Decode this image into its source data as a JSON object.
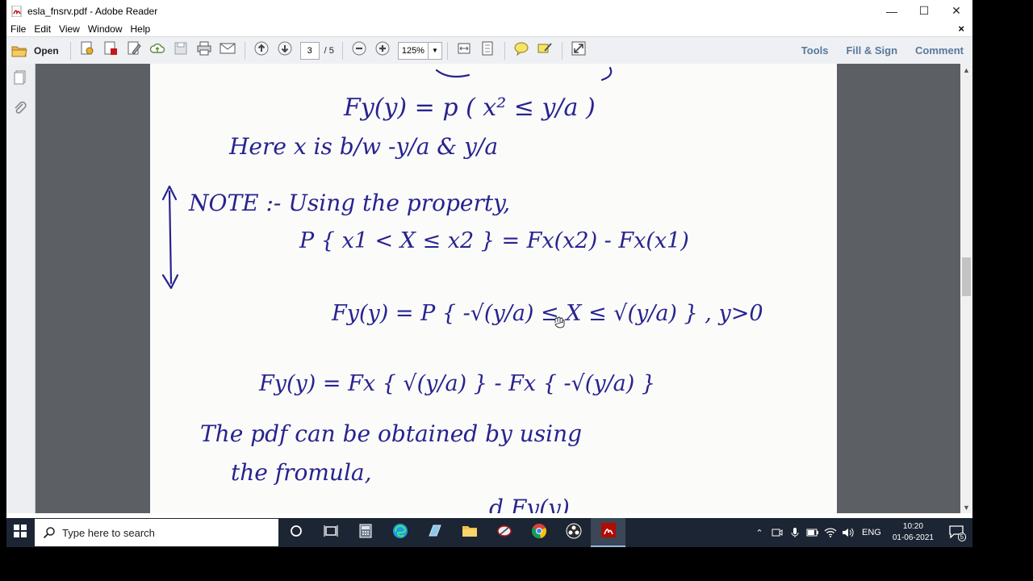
{
  "window": {
    "title": "esla_fnsrv.pdf - Adobe Reader",
    "minimize_glyph": "—",
    "maximize_glyph": "☐",
    "close_glyph": "✕"
  },
  "menu": {
    "items": [
      "File",
      "Edit",
      "View",
      "Window",
      "Help"
    ],
    "close_glyph": "×"
  },
  "toolbar": {
    "open_label": "Open",
    "current_page": "3",
    "total_pages": "/ 5",
    "zoom": "125%",
    "tools_label": "Tools",
    "fill_sign_label": "Fill & Sign",
    "comment_label": "Comment"
  },
  "document": {
    "handwritten_lines": [
      "Fy(y) = p ( x² ≤ y/a )",
      "Here x is b/w -y/a & y/a",
      "NOTE :- Using the property,",
      "P { x1 < X ≤ x2 } = Fx(x2) - Fx(x1)",
      "Fy(y) = P { -√(y/a) ≤ X ≤ √(y/a) } , y>0",
      "Fy(y) = Fx { √(y/a) } - Fx { -√(y/a) }",
      "The pdf can be obtained by using",
      "the fromula,",
      "d Fy(y)"
    ]
  },
  "taskbar": {
    "search_placeholder": "Type here to search",
    "language": "ENG",
    "time": "10:20",
    "date": "01-06-2021",
    "notification_count": "5"
  },
  "colors": {
    "ink": "#27238f",
    "accent_link": "#58799a",
    "taskbar_bg": "#1c2533"
  }
}
